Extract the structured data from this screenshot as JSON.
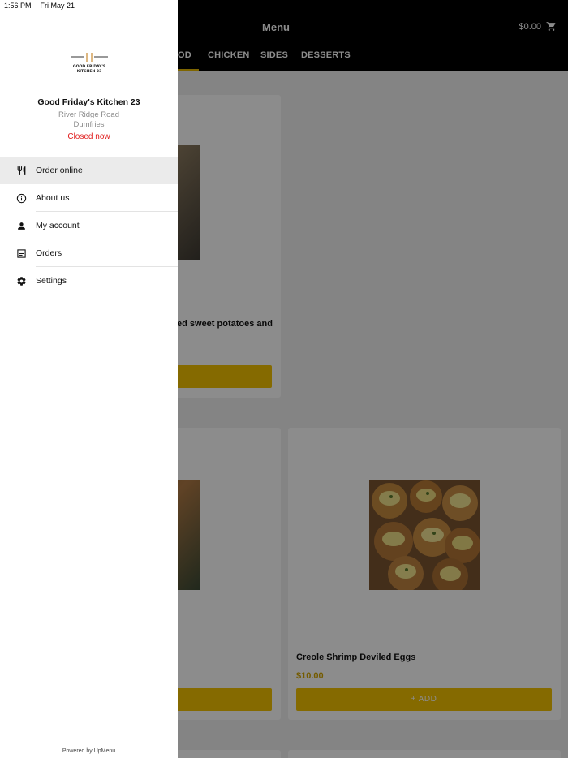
{
  "status_bar": {
    "time": "1:56 PM",
    "date": "Fri May 21"
  },
  "header": {
    "title": "Menu",
    "cart_total": "$0.00"
  },
  "categories": [
    {
      "label": "OD",
      "active": true
    },
    {
      "label": "CHICKEN",
      "active": false
    },
    {
      "label": "SIDES",
      "active": false
    },
    {
      "label": "DESSERTS",
      "active": false
    }
  ],
  "items": [
    {
      "name": "ed sweet potatoes and",
      "price": "",
      "add_label": ""
    },
    {
      "name": "",
      "price": "",
      "add_label": ""
    },
    {
      "name": "Creole Shrimp Deviled Eggs",
      "price": "$10.00",
      "add_label": "+ ADD"
    }
  ],
  "drawer": {
    "logo_text_line1": "GOOD FRIDAY'S",
    "logo_text_line2": "KITCHEN 23",
    "restaurant_name": "Good Friday's Kitchen 23",
    "address_line1": "River Ridge Road",
    "address_line2": "Dumfries",
    "open_status": "Closed now",
    "menu_items": [
      {
        "label": "Order online",
        "icon": "fork-knife-icon",
        "active": true
      },
      {
        "label": "About us",
        "icon": "info-icon",
        "active": false
      },
      {
        "label": "My account",
        "icon": "person-icon",
        "active": false
      },
      {
        "label": "Orders",
        "icon": "receipt-icon",
        "active": false
      },
      {
        "label": "Settings",
        "icon": "gear-icon",
        "active": false
      }
    ],
    "powered_by": "Powered by UpMenu"
  },
  "colors": {
    "accent": "#f2c100",
    "price": "#d4a600",
    "closed": "#e01c1c",
    "topbar": "#000000"
  }
}
